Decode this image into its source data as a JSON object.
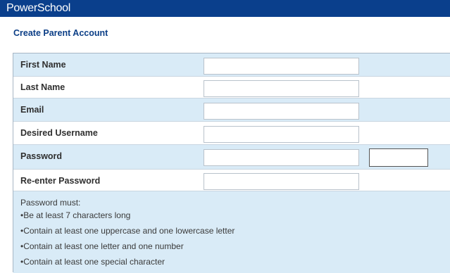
{
  "app": {
    "logo_text": "PowerSchool"
  },
  "page": {
    "title": "Create Parent Account"
  },
  "form": {
    "fields": [
      {
        "label": "First Name",
        "value": ""
      },
      {
        "label": "Last Name",
        "value": ""
      },
      {
        "label": "Email",
        "value": ""
      },
      {
        "label": "Desired Username",
        "value": ""
      },
      {
        "label": "Password",
        "value": ""
      },
      {
        "label": "Re-enter Password",
        "value": ""
      }
    ]
  },
  "password_rules": {
    "heading": "Password must:",
    "items": [
      "•Be at least 7 characters long",
      "•Contain at least one uppercase and one lowercase letter",
      "•Contain at least one letter and one number",
      "•Contain at least one special character"
    ]
  },
  "colors": {
    "header_bg": "#0a3f8c",
    "title_color": "#0b3e86",
    "row_alt_bg": "#d9ebf7"
  }
}
